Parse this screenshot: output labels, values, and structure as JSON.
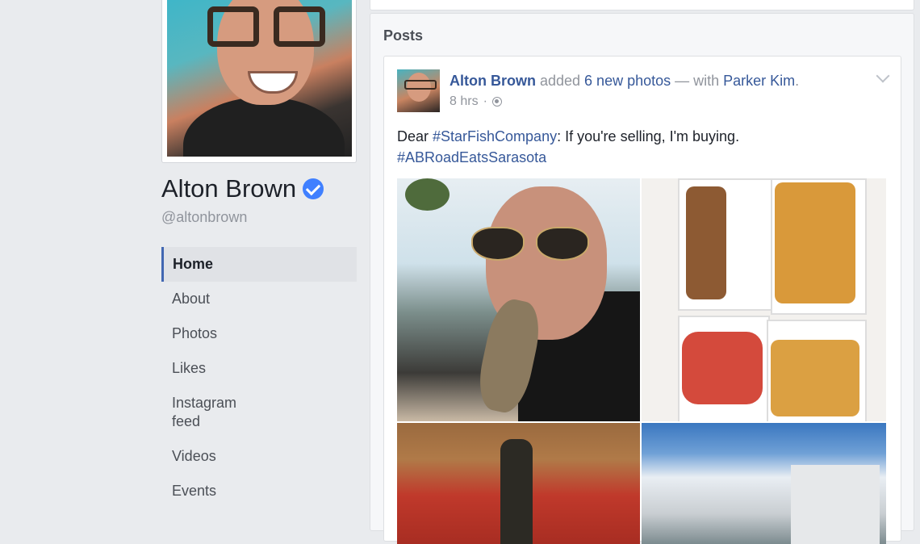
{
  "profile": {
    "name": "Alton Brown",
    "handle": "@altonbrown",
    "verified": true
  },
  "nav": {
    "items": [
      {
        "label": "Home",
        "active": true
      },
      {
        "label": "About"
      },
      {
        "label": "Photos"
      },
      {
        "label": "Likes"
      },
      {
        "label": "Instagram feed"
      },
      {
        "label": "Videos"
      },
      {
        "label": "Events"
      }
    ]
  },
  "posts": {
    "header": "Posts",
    "post": {
      "author": "Alton Brown",
      "action": " added ",
      "photos_link": "6 new photos",
      "with_text": " — with ",
      "tagged": "Parker Kim",
      "tagged_suffix": ".",
      "time": "8 hrs",
      "time_sep": "·",
      "privacy_icon": "globe-icon",
      "text_prefix": "Dear ",
      "hashtag1": "#StarFishCompany",
      "text_body": ": If you're selling, I'm buying.",
      "hashtag2": "#ABRoadEatsSarasota"
    }
  },
  "colors": {
    "link": "#365899",
    "accent": "#4267b2",
    "verified": "#4080ff",
    "background": "#e9ebee"
  }
}
